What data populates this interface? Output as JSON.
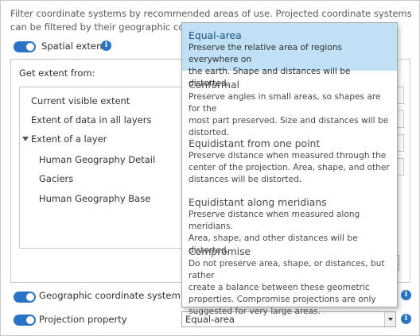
{
  "description": "Filter coordinate systems by recommended areas of use. Projected coordinate systems can be filtered by their geographic coordinate sy",
  "spatial_extent": {
    "label": "Spatial extent",
    "enabled": true
  },
  "extent_panel": {
    "get_extent_label": "Get extent from:",
    "tree_items": [
      {
        "label": "Current visible extent",
        "level": 0
      },
      {
        "label": "Extent of data in all layers",
        "level": 0
      },
      {
        "label": "Extent of a layer",
        "level": 0,
        "expanded": true
      },
      {
        "label": "Human Geography Detail",
        "level": 1
      },
      {
        "label": "Gaciers",
        "level": 1
      },
      {
        "label": "Human Geography Base",
        "level": 1
      }
    ]
  },
  "geographic_cs": {
    "label": "Geographic coordinate system",
    "enabled": true
  },
  "projection_property": {
    "label": "Projection property",
    "enabled": true,
    "selected": "Equal-area",
    "options": [
      {
        "title": "Equal-area",
        "desc_lines": [
          "Preserve the relative area of regions everywhere on",
          "the earth. Shape and distances will be distorted."
        ],
        "selected": true
      },
      {
        "title": "Conformal",
        "desc_lines": [
          "Preserve angles in small areas, so shapes are for the",
          "most part preserved. Size and distances will be",
          "distorted."
        ],
        "selected": false
      },
      {
        "title": "Equidistant from one point",
        "desc_lines": [
          "Preserve distance when measured through the",
          "center of the projection. Area, shape, and other",
          "distances will be distorted."
        ],
        "selected": false
      },
      {
        "title": "Equidistant along meridians",
        "desc_lines": [
          "Preserve distance when measured along meridians.",
          "Area, shape, and other distances will be distorted."
        ],
        "selected": false
      },
      {
        "title": "Compromise",
        "desc_lines": [
          "Do not preserve area, shape, or distances, but rather",
          "create a balance between these geometric",
          "properties. Compromise projections are only",
          "suggested for very large areas."
        ],
        "selected": false
      }
    ]
  },
  "colors": {
    "accent": "#2a73c4",
    "selected_bg": "#bfe0f5"
  },
  "icons": {
    "info": "info-icon",
    "toggle": "toggle-switch",
    "expand": "expand-triangle-icon",
    "dropdown": "chevron-down-icon"
  }
}
